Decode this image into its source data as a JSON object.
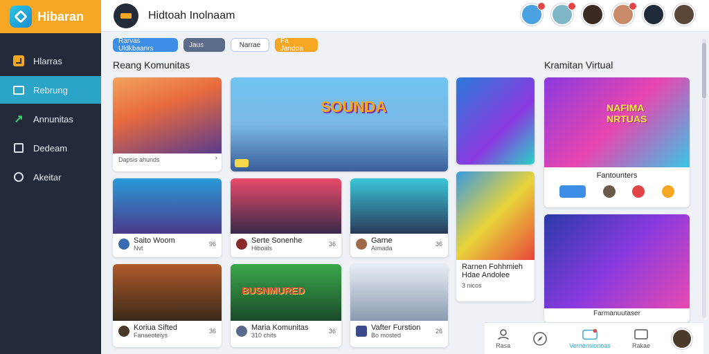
{
  "app": {
    "name": "Hibaran",
    "page_title": "Hidtoah Inolnaam"
  },
  "sidebar": {
    "items": [
      {
        "label": "Hlarras",
        "icon": "checkbox-icon"
      },
      {
        "label": "Rebrung",
        "icon": "screen-icon"
      },
      {
        "label": "Annunitas",
        "icon": "arrow-icon"
      },
      {
        "label": "Dedeam",
        "icon": "square-icon"
      },
      {
        "label": "Akeitar",
        "icon": "chat-icon"
      }
    ]
  },
  "chips": [
    "Rarvas Uldkbaanrs",
    "Jaus",
    "Narrae",
    "Fa Jandoa"
  ],
  "sections": {
    "left": "Reang Komunitas",
    "right": "Kramitan Virtual"
  },
  "cards": {
    "c1": {
      "caption": "Dapsis ahunds"
    },
    "c2": {
      "banner": "SOUNDA"
    },
    "c4": {
      "title": "Saito Woom",
      "sub": "Nvt",
      "count": "96"
    },
    "c5": {
      "title": "Serte Sonenhe",
      "sub": "Hiboals",
      "count": "36"
    },
    "c6": {
      "title": "Garne",
      "sub": "Aimada",
      "count": "36"
    },
    "c7": {
      "title": "Rarnen Fohhmieh",
      "sub": "Hdae Andolee",
      "count": "3 nicos"
    },
    "c8": {
      "banner": "NAFIMA NRTUAS",
      "title": "Fantounters"
    },
    "c10": {
      "title": "Koriua Sifted",
      "sub": "Fanaeoteiys",
      "count": "36"
    },
    "c11": {
      "banner": "BUSNMURED",
      "title": "Maria Komunitas",
      "sub": "310 chits",
      "count": "36"
    },
    "c12": {
      "title": "Vafter Furstion",
      "sub": "Bo mosted",
      "count": "26"
    },
    "c13": {
      "title": "Farmanuutaser"
    }
  },
  "bottombar": [
    {
      "label": "Rasa",
      "icon": "people-icon"
    },
    {
      "label": "",
      "icon": "compass-icon"
    },
    {
      "label": "Vernensionoas",
      "icon": "live-icon"
    },
    {
      "label": "Rakae",
      "icon": "message-icon"
    }
  ]
}
